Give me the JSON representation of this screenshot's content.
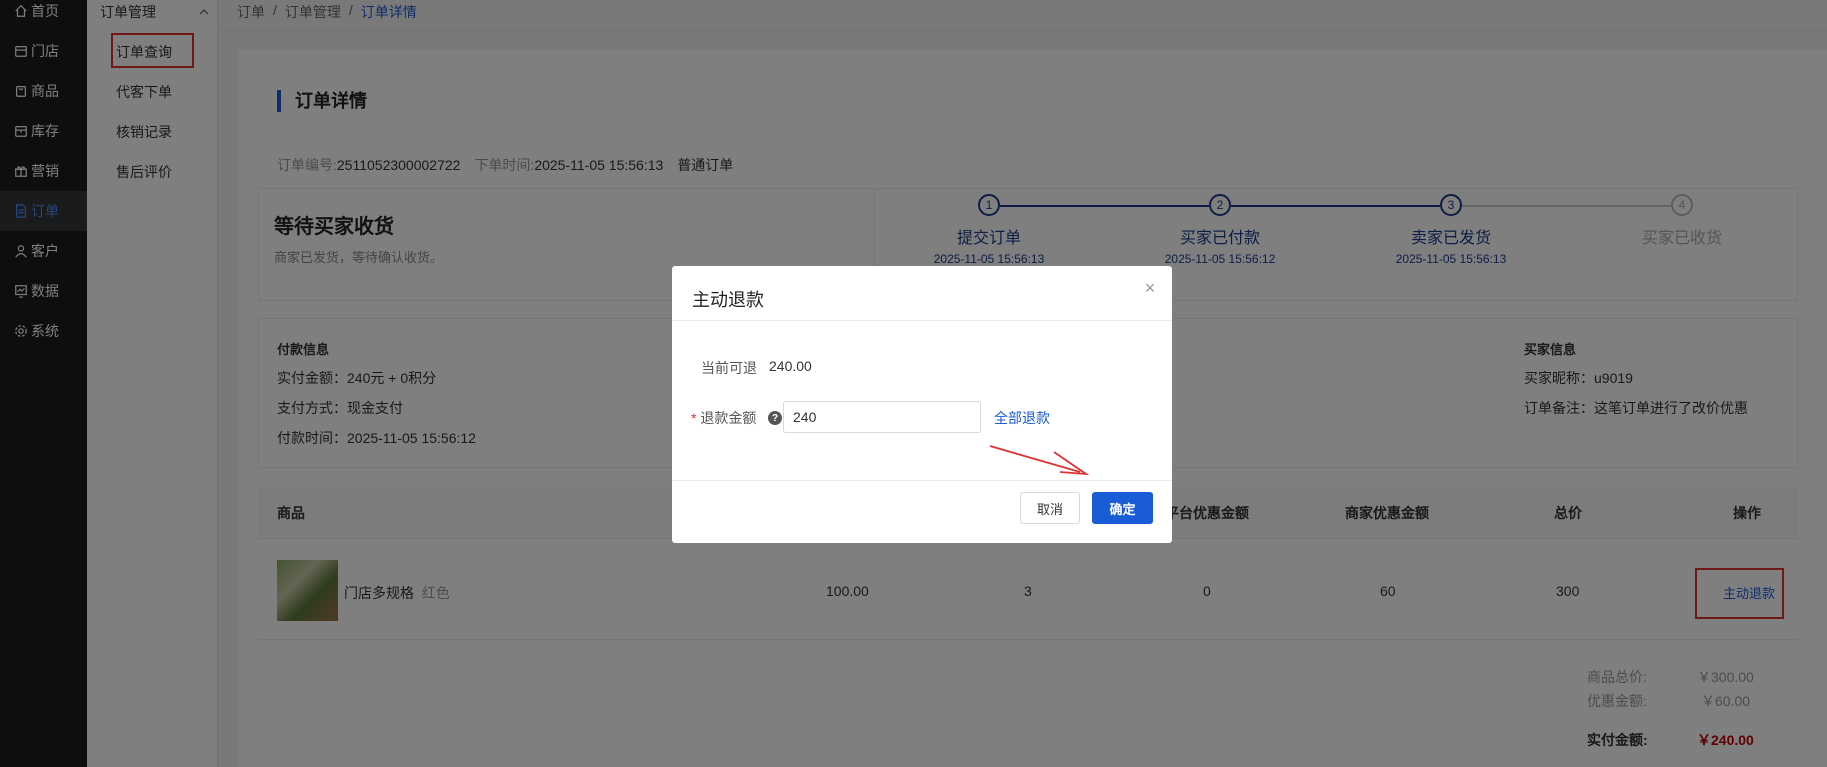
{
  "sidebar": {
    "items": [
      {
        "label": "首页",
        "icon": "home-icon"
      },
      {
        "label": "门店",
        "icon": "store-icon"
      },
      {
        "label": "商品",
        "icon": "bag-icon"
      },
      {
        "label": "库存",
        "icon": "box-icon"
      },
      {
        "label": "营销",
        "icon": "gift-icon"
      },
      {
        "label": "订单",
        "icon": "document-icon",
        "active": true
      },
      {
        "label": "客户",
        "icon": "user-icon"
      },
      {
        "label": "数据",
        "icon": "chart-icon"
      },
      {
        "label": "系统",
        "icon": "gear-icon"
      }
    ]
  },
  "submenu": {
    "title": "订单管理",
    "items": [
      "订单查询",
      "代客下单",
      "核销记录",
      "售后评价"
    ]
  },
  "breadcrumb": {
    "items": [
      "订单",
      "订单管理",
      "订单详情"
    ],
    "separator": "/"
  },
  "page": {
    "title": "订单详情",
    "order_no_label": "订单编号:",
    "order_no": "2511052300002722",
    "order_time_label": "下单时间:",
    "order_time": "2025-11-05 15:56:13",
    "order_type": "普通订单"
  },
  "status": {
    "main": "等待买家收货",
    "sub": "商家已发货，等待确认收货。",
    "steps": [
      {
        "num": "1",
        "label": "提交订单",
        "time": "2025-11-05 15:56:13",
        "done": true
      },
      {
        "num": "2",
        "label": "买家已付款",
        "time": "2025-11-05 15:56:12",
        "done": true
      },
      {
        "num": "3",
        "label": "卖家已发货",
        "time": "2025-11-05 15:56:13",
        "done": true
      },
      {
        "num": "4",
        "label": "买家已收货",
        "time": "",
        "done": false
      }
    ]
  },
  "payment": {
    "heading": "付款信息",
    "lines": [
      "实付金额：240元 + 0积分",
      "支付方式：现金支付",
      "付款时间：2025-11-05 15:56:12"
    ]
  },
  "buyer": {
    "heading": "买家信息",
    "lines": [
      "买家昵称：u9019",
      "订单备注：这笔订单进行了改价优惠"
    ]
  },
  "table": {
    "headers": {
      "product": "商品",
      "platform_discount": "平台优惠金额",
      "merchant_discount": "商家优惠金额",
      "total": "总价",
      "action": "操作"
    },
    "row": {
      "name": "门店多规格",
      "spec": "红色",
      "price": "100.00",
      "qty": "3",
      "platform_discount": "0",
      "merchant_discount": "60",
      "total": "300",
      "action": "主动退款"
    }
  },
  "summary": {
    "goods_total_label": "商品总价:",
    "goods_total": "￥300.00",
    "discount_label": "优惠金额:",
    "discount": "￥60.00",
    "paid_label": "实付金额:",
    "paid": "￥240.00"
  },
  "modal": {
    "title": "主动退款",
    "close": "×",
    "refundable_label": "当前可退",
    "refundable": "240.00",
    "req_mark": "*",
    "amount_label": "退款金额",
    "help": "?",
    "amount_value": "240",
    "all_refund": "全部退款",
    "cancel": "取消",
    "ok": "确定"
  },
  "colors": {
    "accent": "#1a5bd6",
    "highlight": "#e03131",
    "price": "#c00000"
  }
}
